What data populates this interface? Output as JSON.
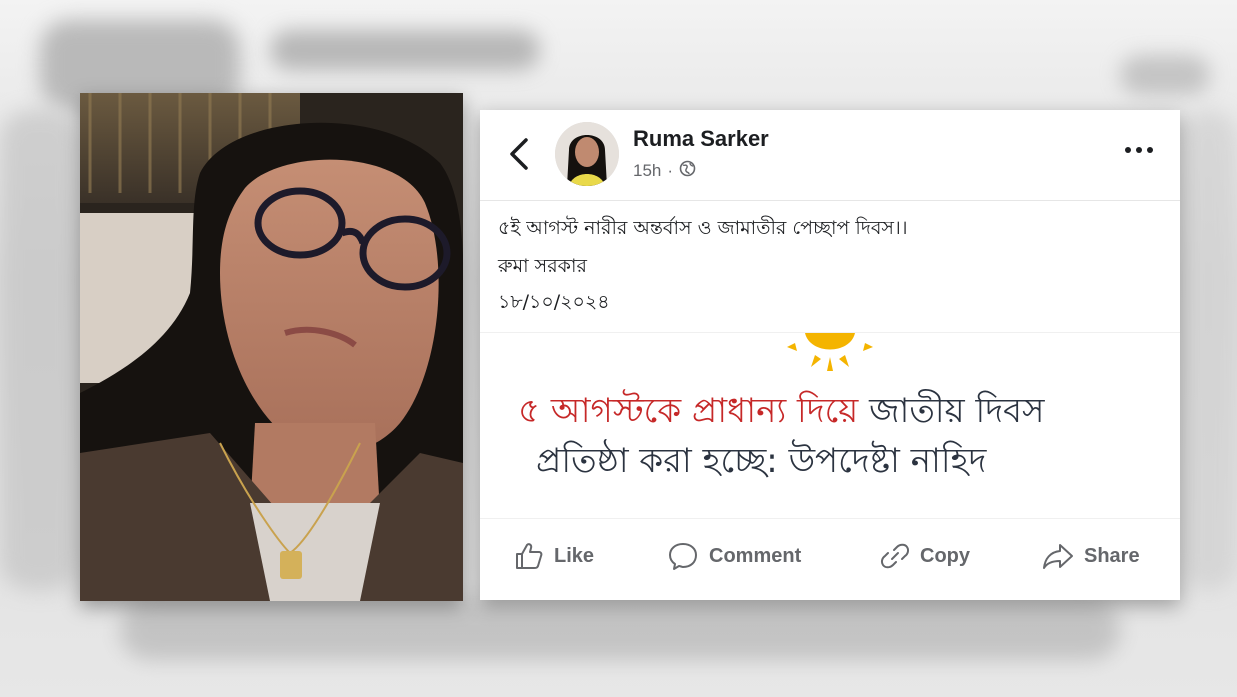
{
  "post": {
    "author": "Ruma Sarker",
    "time": "15h",
    "privacy_icon": "globe-icon",
    "text_lines": [
      "৫ই আগস্ট নারীর অন্তর্বাস ও জামাতীর পেচ্ছাপ দিবস।।",
      "রুমা সরকার",
      "১৮/১০/২০২৪"
    ]
  },
  "shared_image": {
    "headline_red": "৫ আগস্টকে প্রাধান্য দিয়ে",
    "headline_dark": " জাতীয় দিবস",
    "headline_line2": "প্রতিষ্ঠা করা হচ্ছে: উপদেষ্টা নাহিদ"
  },
  "actions": {
    "like": "Like",
    "comment": "Comment",
    "copy": "Copy",
    "share": "Share"
  },
  "colors": {
    "headline_red": "#c62828",
    "headline_dark": "#2b3340",
    "meta_gray": "#65676b"
  }
}
